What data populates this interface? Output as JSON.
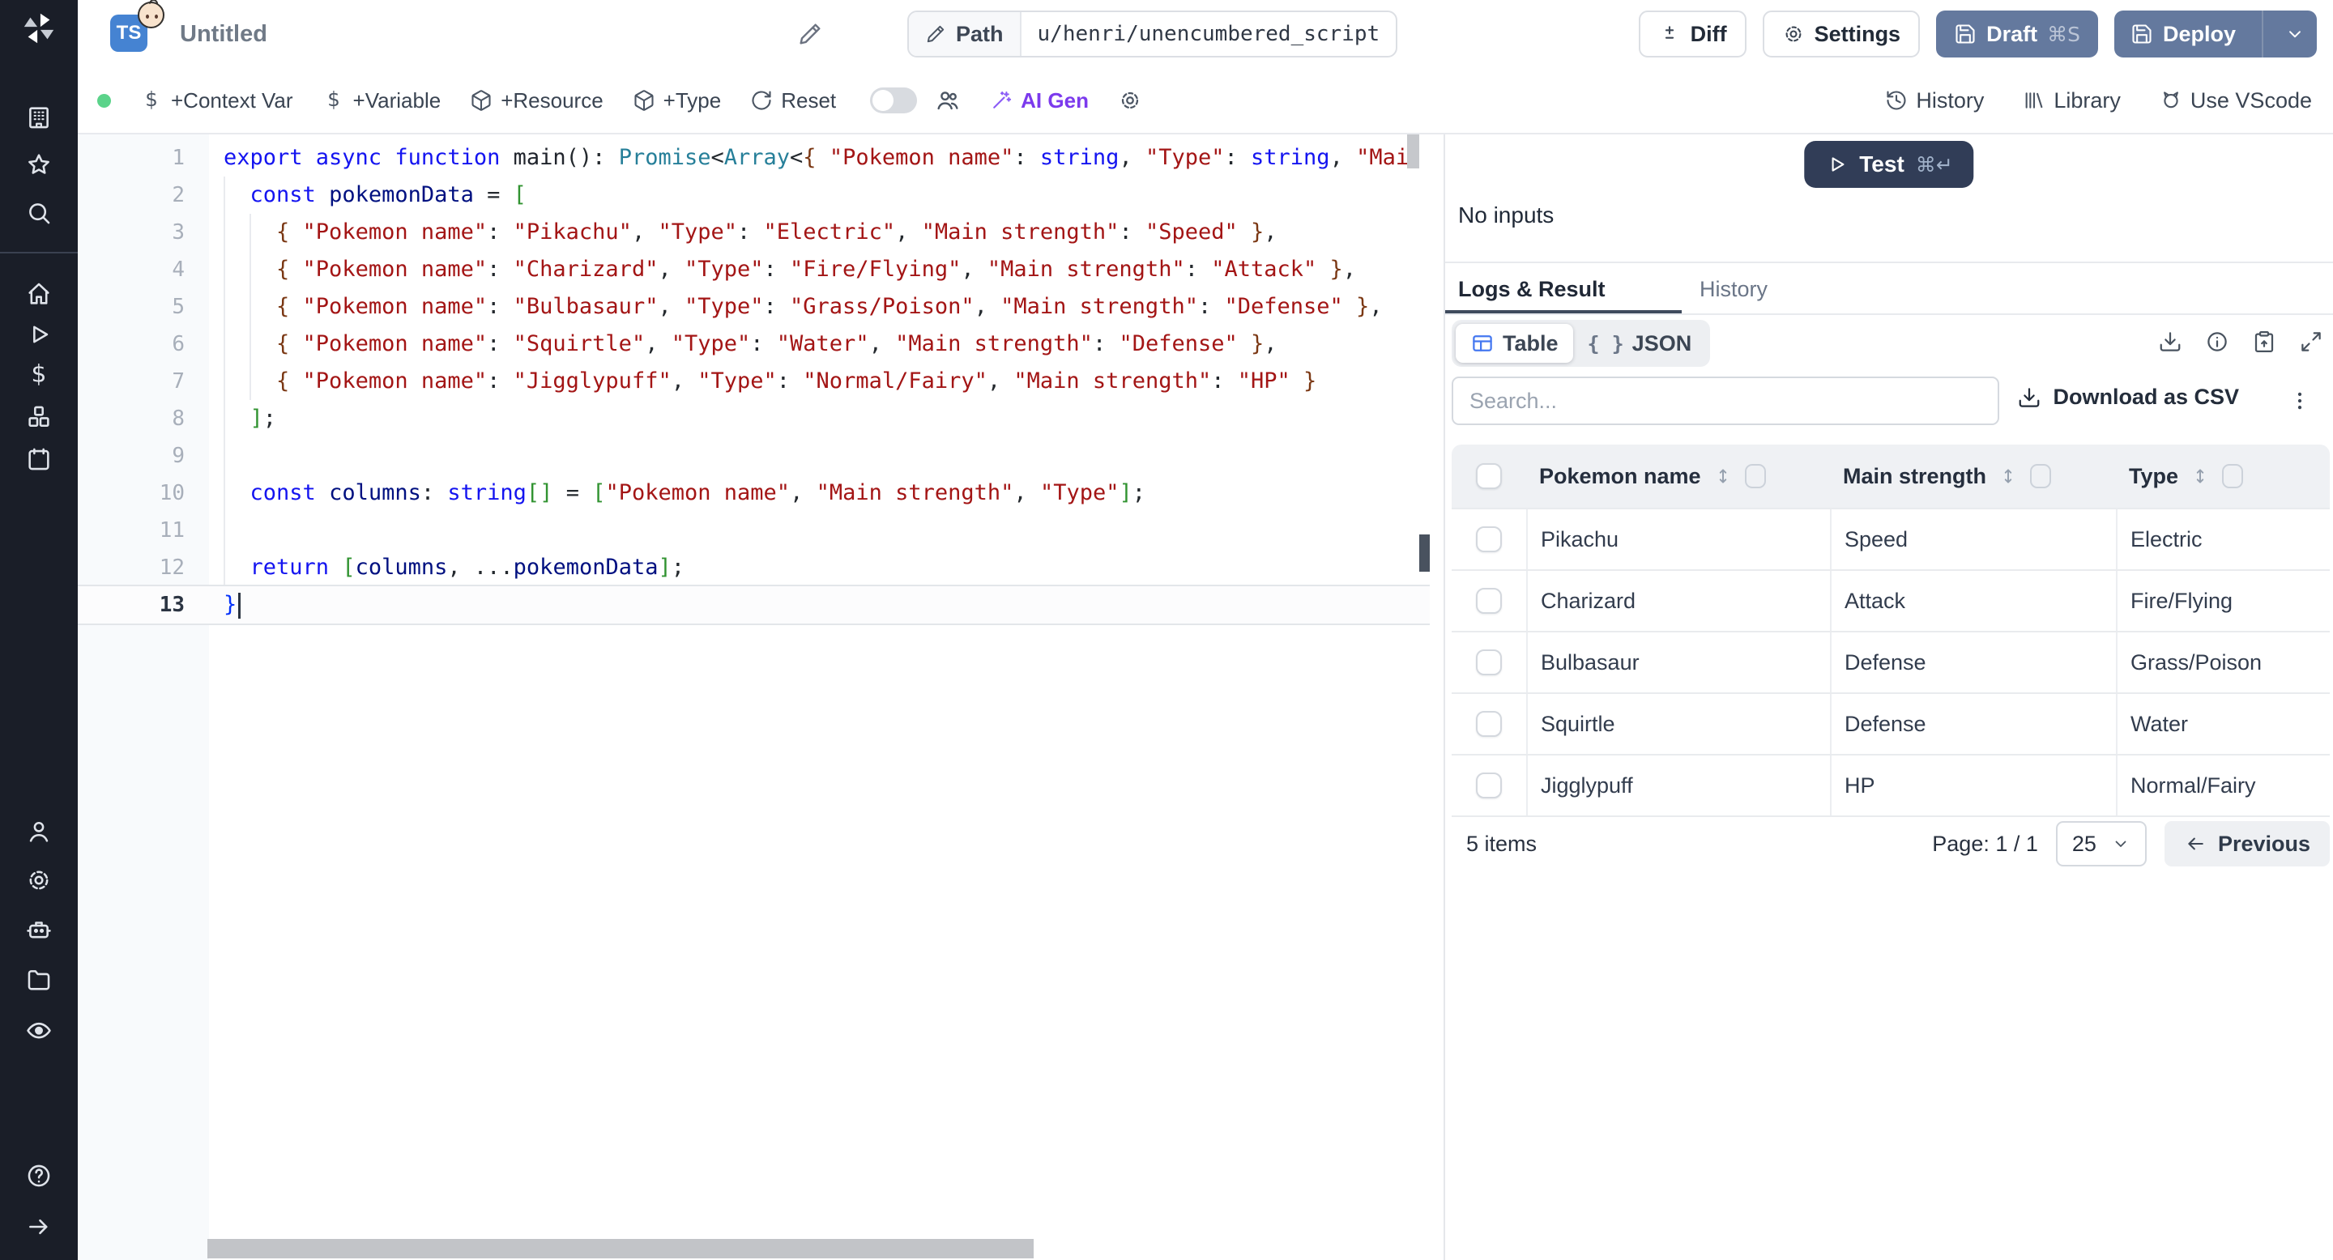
{
  "colors": {
    "primary_button": "#64799e",
    "test_button": "#313d57",
    "ai_purple": "#7c3aed",
    "status_green": "#5bd38a",
    "table_icon_blue": "#4477f0",
    "ts_badge_blue": "#4583d2",
    "sidebar_bg": "#1a1e28"
  },
  "sidebar": {
    "icons": [
      "windmill-logo",
      "buildings-icon",
      "star-icon",
      "search-icon",
      "home-icon",
      "play-icon",
      "dollar-icon",
      "cubes-icon",
      "calendar-icon",
      "user-icon",
      "gear-icon",
      "robot-icon",
      "folder-icon",
      "eye-icon",
      "help-icon",
      "arrow-right-icon"
    ]
  },
  "topbar": {
    "language_badge": "TS",
    "emoji": "baby-face",
    "title": "Untitled",
    "path_label": "Path",
    "path_value": "u/henri/unencumbered_script",
    "diff_label": "Diff",
    "settings_label": "Settings",
    "draft_label": "Draft",
    "draft_shortcut": "⌘S",
    "deploy_label": "Deploy"
  },
  "toolbar": {
    "add_context_var": "+Context Var",
    "add_variable": "+Variable",
    "add_resource": "+Resource",
    "add_type": "+Type",
    "reset": "Reset",
    "ai_gen": "AI Gen",
    "history": "History",
    "library": "Library",
    "use_vscode": "Use VScode"
  },
  "editor": {
    "lines": [
      {
        "n": 1,
        "seg": [
          [
            "kw",
            "export async function "
          ],
          [
            "fn",
            "main"
          ],
          [
            "pl",
            "(): "
          ],
          [
            "ty",
            "Promise"
          ],
          [
            "pl",
            "<"
          ],
          [
            "ty",
            "Array"
          ],
          [
            "pl",
            "<"
          ],
          [
            "b3",
            "{ "
          ],
          [
            "str",
            "\"Pokemon name\""
          ],
          [
            "pl",
            ": "
          ],
          [
            "kw",
            "string"
          ],
          [
            "pl",
            ", "
          ],
          [
            "str",
            "\"Type\""
          ],
          [
            "pl",
            ": "
          ],
          [
            "kw",
            "string"
          ],
          [
            "pl",
            ", "
          ],
          [
            "str",
            "\"Mai"
          ]
        ]
      },
      {
        "n": 2,
        "seg": [
          [
            "pl",
            "  "
          ],
          [
            "kw",
            "const"
          ],
          [
            "pl",
            " "
          ],
          [
            "id",
            "pokemonData"
          ],
          [
            "pl",
            " = "
          ],
          [
            "b2",
            "["
          ]
        ]
      },
      {
        "n": 3,
        "seg": [
          [
            "pl",
            "    "
          ],
          [
            "b3",
            "{ "
          ],
          [
            "str",
            "\"Pokemon name\""
          ],
          [
            "pl",
            ": "
          ],
          [
            "str",
            "\"Pikachu\""
          ],
          [
            "pl",
            ", "
          ],
          [
            "str",
            "\"Type\""
          ],
          [
            "pl",
            ": "
          ],
          [
            "str",
            "\"Electric\""
          ],
          [
            "pl",
            ", "
          ],
          [
            "str",
            "\"Main strength\""
          ],
          [
            "pl",
            ": "
          ],
          [
            "str",
            "\"Speed\""
          ],
          [
            "b3",
            " }"
          ],
          [
            "pl",
            ","
          ]
        ]
      },
      {
        "n": 4,
        "seg": [
          [
            "pl",
            "    "
          ],
          [
            "b3",
            "{ "
          ],
          [
            "str",
            "\"Pokemon name\""
          ],
          [
            "pl",
            ": "
          ],
          [
            "str",
            "\"Charizard\""
          ],
          [
            "pl",
            ", "
          ],
          [
            "str",
            "\"Type\""
          ],
          [
            "pl",
            ": "
          ],
          [
            "str",
            "\"Fire/Flying\""
          ],
          [
            "pl",
            ", "
          ],
          [
            "str",
            "\"Main strength\""
          ],
          [
            "pl",
            ": "
          ],
          [
            "str",
            "\"Attack\""
          ],
          [
            "b3",
            " }"
          ],
          [
            "pl",
            ","
          ]
        ]
      },
      {
        "n": 5,
        "seg": [
          [
            "pl",
            "    "
          ],
          [
            "b3",
            "{ "
          ],
          [
            "str",
            "\"Pokemon name\""
          ],
          [
            "pl",
            ": "
          ],
          [
            "str",
            "\"Bulbasaur\""
          ],
          [
            "pl",
            ", "
          ],
          [
            "str",
            "\"Type\""
          ],
          [
            "pl",
            ": "
          ],
          [
            "str",
            "\"Grass/Poison\""
          ],
          [
            "pl",
            ", "
          ],
          [
            "str",
            "\"Main strength\""
          ],
          [
            "pl",
            ": "
          ],
          [
            "str",
            "\"Defense\""
          ],
          [
            "b3",
            " }"
          ],
          [
            "pl",
            ","
          ]
        ]
      },
      {
        "n": 6,
        "seg": [
          [
            "pl",
            "    "
          ],
          [
            "b3",
            "{ "
          ],
          [
            "str",
            "\"Pokemon name\""
          ],
          [
            "pl",
            ": "
          ],
          [
            "str",
            "\"Squirtle\""
          ],
          [
            "pl",
            ", "
          ],
          [
            "str",
            "\"Type\""
          ],
          [
            "pl",
            ": "
          ],
          [
            "str",
            "\"Water\""
          ],
          [
            "pl",
            ", "
          ],
          [
            "str",
            "\"Main strength\""
          ],
          [
            "pl",
            ": "
          ],
          [
            "str",
            "\"Defense\""
          ],
          [
            "b3",
            " }"
          ],
          [
            "pl",
            ","
          ]
        ]
      },
      {
        "n": 7,
        "seg": [
          [
            "pl",
            "    "
          ],
          [
            "b3",
            "{ "
          ],
          [
            "str",
            "\"Pokemon name\""
          ],
          [
            "pl",
            ": "
          ],
          [
            "str",
            "\"Jigglypuff\""
          ],
          [
            "pl",
            ", "
          ],
          [
            "str",
            "\"Type\""
          ],
          [
            "pl",
            ": "
          ],
          [
            "str",
            "\"Normal/Fairy\""
          ],
          [
            "pl",
            ", "
          ],
          [
            "str",
            "\"Main strength\""
          ],
          [
            "pl",
            ": "
          ],
          [
            "str",
            "\"HP\""
          ],
          [
            "b3",
            " }"
          ]
        ]
      },
      {
        "n": 8,
        "seg": [
          [
            "pl",
            "  "
          ],
          [
            "b2",
            "]"
          ],
          [
            "pl",
            ";"
          ]
        ]
      },
      {
        "n": 9,
        "seg": []
      },
      {
        "n": 10,
        "seg": [
          [
            "pl",
            "  "
          ],
          [
            "kw",
            "const"
          ],
          [
            "pl",
            " "
          ],
          [
            "id",
            "columns"
          ],
          [
            "pl",
            ": "
          ],
          [
            "kw",
            "string"
          ],
          [
            "b2",
            "[]"
          ],
          [
            "pl",
            " = "
          ],
          [
            "b2",
            "["
          ],
          [
            "str",
            "\"Pokemon name\""
          ],
          [
            "pl",
            ", "
          ],
          [
            "str",
            "\"Main strength\""
          ],
          [
            "pl",
            ", "
          ],
          [
            "str",
            "\"Type\""
          ],
          [
            "b2",
            "]"
          ],
          [
            "pl",
            ";"
          ]
        ]
      },
      {
        "n": 11,
        "seg": []
      },
      {
        "n": 12,
        "seg": [
          [
            "pl",
            "  "
          ],
          [
            "kw",
            "return"
          ],
          [
            "pl",
            " "
          ],
          [
            "b2",
            "["
          ],
          [
            "id",
            "columns"
          ],
          [
            "pl",
            ", ..."
          ],
          [
            "id",
            "pokemonData"
          ],
          [
            "b2",
            "]"
          ],
          [
            "pl",
            ";"
          ]
        ]
      },
      {
        "n": 13,
        "active": true,
        "seg": [
          [
            "b1",
            "}"
          ]
        ]
      }
    ]
  },
  "run": {
    "test_label": "Test",
    "test_shortcut": "⌘↵",
    "no_inputs": "No inputs",
    "tab_logs": "Logs & Result",
    "tab_history": "History"
  },
  "result": {
    "view_table": "Table",
    "view_json": "JSON",
    "json_glyph": "{ }",
    "search_placeholder": "Search...",
    "download_csv": "Download as CSV",
    "table": {
      "columns": [
        "Pokemon name",
        "Main strength",
        "Type"
      ],
      "rows": [
        [
          "Pikachu",
          "Speed",
          "Electric"
        ],
        [
          "Charizard",
          "Attack",
          "Fire/Flying"
        ],
        [
          "Bulbasaur",
          "Defense",
          "Grass/Poison"
        ],
        [
          "Squirtle",
          "Defense",
          "Water"
        ],
        [
          "Jigglypuff",
          "HP",
          "Normal/Fairy"
        ]
      ]
    },
    "footer": {
      "count": "5 items",
      "page": "Page: 1 / 1",
      "page_size": "25",
      "previous": "Previous"
    }
  }
}
